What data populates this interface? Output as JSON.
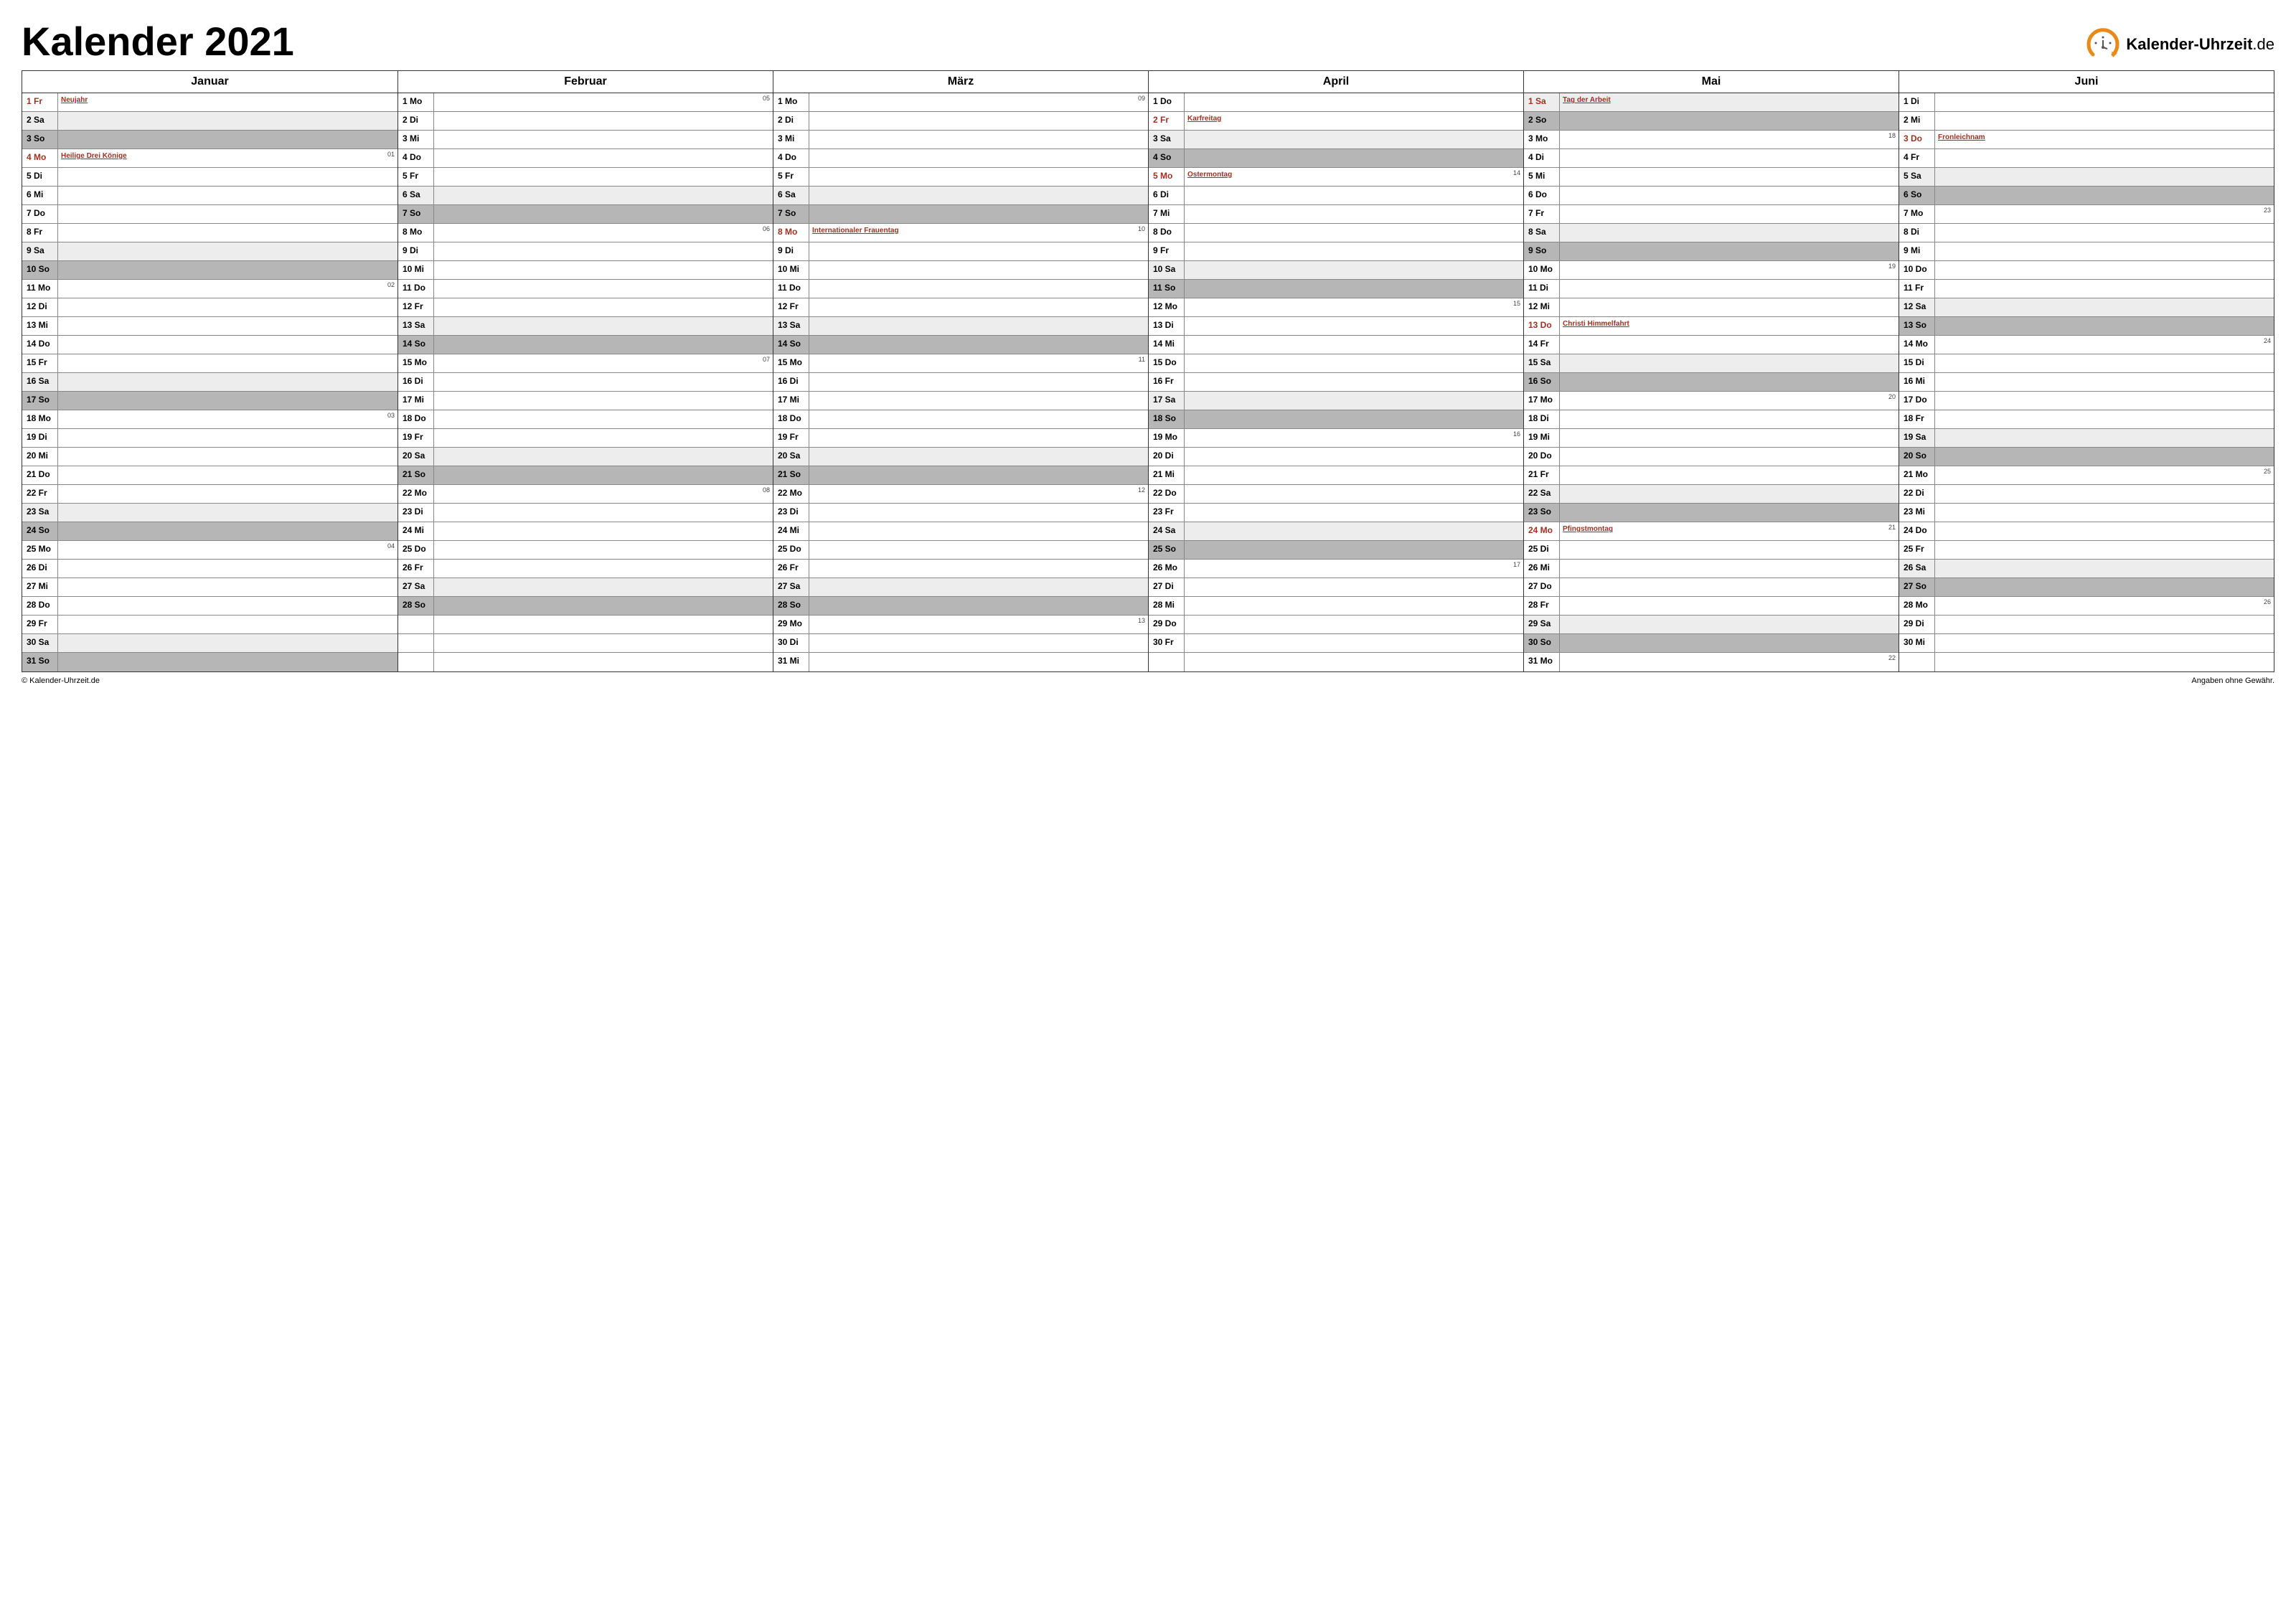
{
  "title": "Kalender 2021",
  "brand_prefix": "Kalender-Uhrzeit",
  "brand_suffix": ".de",
  "brand_color": "#e88a1a",
  "footer_left": "© Kalender-Uhrzeit.de",
  "footer_right": "Angaben ohne Gewähr.",
  "months": [
    {
      "name": "Januar",
      "days": [
        {
          "n": "1",
          "d": "Fr",
          "hol": "Neujahr"
        },
        {
          "n": "2",
          "d": "Sa"
        },
        {
          "n": "3",
          "d": "So"
        },
        {
          "n": "4",
          "d": "Mo",
          "hol": "Heilige Drei Könige",
          "wk": "01"
        },
        {
          "n": "5",
          "d": "Di"
        },
        {
          "n": "6",
          "d": "Mi"
        },
        {
          "n": "7",
          "d": "Do"
        },
        {
          "n": "8",
          "d": "Fr"
        },
        {
          "n": "9",
          "d": "Sa"
        },
        {
          "n": "10",
          "d": "So"
        },
        {
          "n": "11",
          "d": "Mo",
          "wk": "02"
        },
        {
          "n": "12",
          "d": "Di"
        },
        {
          "n": "13",
          "d": "Mi"
        },
        {
          "n": "14",
          "d": "Do"
        },
        {
          "n": "15",
          "d": "Fr"
        },
        {
          "n": "16",
          "d": "Sa"
        },
        {
          "n": "17",
          "d": "So"
        },
        {
          "n": "18",
          "d": "Mo",
          "wk": "03"
        },
        {
          "n": "19",
          "d": "Di"
        },
        {
          "n": "20",
          "d": "Mi"
        },
        {
          "n": "21",
          "d": "Do"
        },
        {
          "n": "22",
          "d": "Fr"
        },
        {
          "n": "23",
          "d": "Sa"
        },
        {
          "n": "24",
          "d": "So"
        },
        {
          "n": "25",
          "d": "Mo",
          "wk": "04"
        },
        {
          "n": "26",
          "d": "Di"
        },
        {
          "n": "27",
          "d": "Mi"
        },
        {
          "n": "28",
          "d": "Do"
        },
        {
          "n": "29",
          "d": "Fr"
        },
        {
          "n": "30",
          "d": "Sa"
        },
        {
          "n": "31",
          "d": "So"
        }
      ]
    },
    {
      "name": "Februar",
      "days": [
        {
          "n": "1",
          "d": "Mo",
          "wk": "05"
        },
        {
          "n": "2",
          "d": "Di"
        },
        {
          "n": "3",
          "d": "Mi"
        },
        {
          "n": "4",
          "d": "Do"
        },
        {
          "n": "5",
          "d": "Fr"
        },
        {
          "n": "6",
          "d": "Sa"
        },
        {
          "n": "7",
          "d": "So"
        },
        {
          "n": "8",
          "d": "Mo",
          "wk": "06"
        },
        {
          "n": "9",
          "d": "Di"
        },
        {
          "n": "10",
          "d": "Mi"
        },
        {
          "n": "11",
          "d": "Do"
        },
        {
          "n": "12",
          "d": "Fr"
        },
        {
          "n": "13",
          "d": "Sa"
        },
        {
          "n": "14",
          "d": "So"
        },
        {
          "n": "15",
          "d": "Mo",
          "wk": "07"
        },
        {
          "n": "16",
          "d": "Di"
        },
        {
          "n": "17",
          "d": "Mi"
        },
        {
          "n": "18",
          "d": "Do"
        },
        {
          "n": "19",
          "d": "Fr"
        },
        {
          "n": "20",
          "d": "Sa"
        },
        {
          "n": "21",
          "d": "So"
        },
        {
          "n": "22",
          "d": "Mo",
          "wk": "08"
        },
        {
          "n": "23",
          "d": "Di"
        },
        {
          "n": "24",
          "d": "Mi"
        },
        {
          "n": "25",
          "d": "Do"
        },
        {
          "n": "26",
          "d": "Fr"
        },
        {
          "n": "27",
          "d": "Sa"
        },
        {
          "n": "28",
          "d": "So"
        },
        {
          "empty": true
        },
        {
          "empty": true
        },
        {
          "empty": true
        }
      ]
    },
    {
      "name": "März",
      "days": [
        {
          "n": "1",
          "d": "Mo",
          "wk": "09"
        },
        {
          "n": "2",
          "d": "Di"
        },
        {
          "n": "3",
          "d": "Mi"
        },
        {
          "n": "4",
          "d": "Do"
        },
        {
          "n": "5",
          "d": "Fr"
        },
        {
          "n": "6",
          "d": "Sa"
        },
        {
          "n": "7",
          "d": "So"
        },
        {
          "n": "8",
          "d": "Mo",
          "hol": "Internationaler Frauentag",
          "wk": "10"
        },
        {
          "n": "9",
          "d": "Di"
        },
        {
          "n": "10",
          "d": "Mi"
        },
        {
          "n": "11",
          "d": "Do"
        },
        {
          "n": "12",
          "d": "Fr"
        },
        {
          "n": "13",
          "d": "Sa"
        },
        {
          "n": "14",
          "d": "So"
        },
        {
          "n": "15",
          "d": "Mo",
          "wk": "11"
        },
        {
          "n": "16",
          "d": "Di"
        },
        {
          "n": "17",
          "d": "Mi"
        },
        {
          "n": "18",
          "d": "Do"
        },
        {
          "n": "19",
          "d": "Fr"
        },
        {
          "n": "20",
          "d": "Sa"
        },
        {
          "n": "21",
          "d": "So"
        },
        {
          "n": "22",
          "d": "Mo",
          "wk": "12"
        },
        {
          "n": "23",
          "d": "Di"
        },
        {
          "n": "24",
          "d": "Mi"
        },
        {
          "n": "25",
          "d": "Do"
        },
        {
          "n": "26",
          "d": "Fr"
        },
        {
          "n": "27",
          "d": "Sa"
        },
        {
          "n": "28",
          "d": "So"
        },
        {
          "n": "29",
          "d": "Mo",
          "wk": "13"
        },
        {
          "n": "30",
          "d": "Di"
        },
        {
          "n": "31",
          "d": "Mi"
        }
      ]
    },
    {
      "name": "April",
      "days": [
        {
          "n": "1",
          "d": "Do"
        },
        {
          "n": "2",
          "d": "Fr",
          "hol": "Karfreitag"
        },
        {
          "n": "3",
          "d": "Sa"
        },
        {
          "n": "4",
          "d": "So"
        },
        {
          "n": "5",
          "d": "Mo",
          "hol": "Ostermontag",
          "wk": "14"
        },
        {
          "n": "6",
          "d": "Di"
        },
        {
          "n": "7",
          "d": "Mi"
        },
        {
          "n": "8",
          "d": "Do"
        },
        {
          "n": "9",
          "d": "Fr"
        },
        {
          "n": "10",
          "d": "Sa"
        },
        {
          "n": "11",
          "d": "So"
        },
        {
          "n": "12",
          "d": "Mo",
          "wk": "15"
        },
        {
          "n": "13",
          "d": "Di"
        },
        {
          "n": "14",
          "d": "Mi"
        },
        {
          "n": "15",
          "d": "Do"
        },
        {
          "n": "16",
          "d": "Fr"
        },
        {
          "n": "17",
          "d": "Sa"
        },
        {
          "n": "18",
          "d": "So"
        },
        {
          "n": "19",
          "d": "Mo",
          "wk": "16"
        },
        {
          "n": "20",
          "d": "Di"
        },
        {
          "n": "21",
          "d": "Mi"
        },
        {
          "n": "22",
          "d": "Do"
        },
        {
          "n": "23",
          "d": "Fr"
        },
        {
          "n": "24",
          "d": "Sa"
        },
        {
          "n": "25",
          "d": "So"
        },
        {
          "n": "26",
          "d": "Mo",
          "wk": "17"
        },
        {
          "n": "27",
          "d": "Di"
        },
        {
          "n": "28",
          "d": "Mi"
        },
        {
          "n": "29",
          "d": "Do"
        },
        {
          "n": "30",
          "d": "Fr"
        },
        {
          "empty": true
        }
      ]
    },
    {
      "name": "Mai",
      "days": [
        {
          "n": "1",
          "d": "Sa",
          "hol": "Tag der Arbeit"
        },
        {
          "n": "2",
          "d": "So"
        },
        {
          "n": "3",
          "d": "Mo",
          "wk": "18"
        },
        {
          "n": "4",
          "d": "Di"
        },
        {
          "n": "5",
          "d": "Mi"
        },
        {
          "n": "6",
          "d": "Do"
        },
        {
          "n": "7",
          "d": "Fr"
        },
        {
          "n": "8",
          "d": "Sa"
        },
        {
          "n": "9",
          "d": "So"
        },
        {
          "n": "10",
          "d": "Mo",
          "wk": "19"
        },
        {
          "n": "11",
          "d": "Di"
        },
        {
          "n": "12",
          "d": "Mi"
        },
        {
          "n": "13",
          "d": "Do",
          "hol": "Christi Himmelfahrt"
        },
        {
          "n": "14",
          "d": "Fr"
        },
        {
          "n": "15",
          "d": "Sa"
        },
        {
          "n": "16",
          "d": "So"
        },
        {
          "n": "17",
          "d": "Mo",
          "wk": "20"
        },
        {
          "n": "18",
          "d": "Di"
        },
        {
          "n": "19",
          "d": "Mi"
        },
        {
          "n": "20",
          "d": "Do"
        },
        {
          "n": "21",
          "d": "Fr"
        },
        {
          "n": "22",
          "d": "Sa"
        },
        {
          "n": "23",
          "d": "So"
        },
        {
          "n": "24",
          "d": "Mo",
          "hol": "Pfingstmontag",
          "wk": "21"
        },
        {
          "n": "25",
          "d": "Di"
        },
        {
          "n": "26",
          "d": "Mi"
        },
        {
          "n": "27",
          "d": "Do"
        },
        {
          "n": "28",
          "d": "Fr"
        },
        {
          "n": "29",
          "d": "Sa"
        },
        {
          "n": "30",
          "d": "So"
        },
        {
          "n": "31",
          "d": "Mo",
          "wk": "22"
        }
      ]
    },
    {
      "name": "Juni",
      "days": [
        {
          "n": "1",
          "d": "Di"
        },
        {
          "n": "2",
          "d": "Mi"
        },
        {
          "n": "3",
          "d": "Do",
          "hol": "Fronleichnam"
        },
        {
          "n": "4",
          "d": "Fr"
        },
        {
          "n": "5",
          "d": "Sa"
        },
        {
          "n": "6",
          "d": "So"
        },
        {
          "n": "7",
          "d": "Mo",
          "wk": "23"
        },
        {
          "n": "8",
          "d": "Di"
        },
        {
          "n": "9",
          "d": "Mi"
        },
        {
          "n": "10",
          "d": "Do"
        },
        {
          "n": "11",
          "d": "Fr"
        },
        {
          "n": "12",
          "d": "Sa"
        },
        {
          "n": "13",
          "d": "So"
        },
        {
          "n": "14",
          "d": "Mo",
          "wk": "24"
        },
        {
          "n": "15",
          "d": "Di"
        },
        {
          "n": "16",
          "d": "Mi"
        },
        {
          "n": "17",
          "d": "Do"
        },
        {
          "n": "18",
          "d": "Fr"
        },
        {
          "n": "19",
          "d": "Sa"
        },
        {
          "n": "20",
          "d": "So"
        },
        {
          "n": "21",
          "d": "Mo",
          "wk": "25"
        },
        {
          "n": "22",
          "d": "Di"
        },
        {
          "n": "23",
          "d": "Mi"
        },
        {
          "n": "24",
          "d": "Do"
        },
        {
          "n": "25",
          "d": "Fr"
        },
        {
          "n": "26",
          "d": "Sa"
        },
        {
          "n": "27",
          "d": "So"
        },
        {
          "n": "28",
          "d": "Mo",
          "wk": "26"
        },
        {
          "n": "29",
          "d": "Di"
        },
        {
          "n": "30",
          "d": "Mi"
        },
        {
          "empty": true
        }
      ]
    }
  ]
}
